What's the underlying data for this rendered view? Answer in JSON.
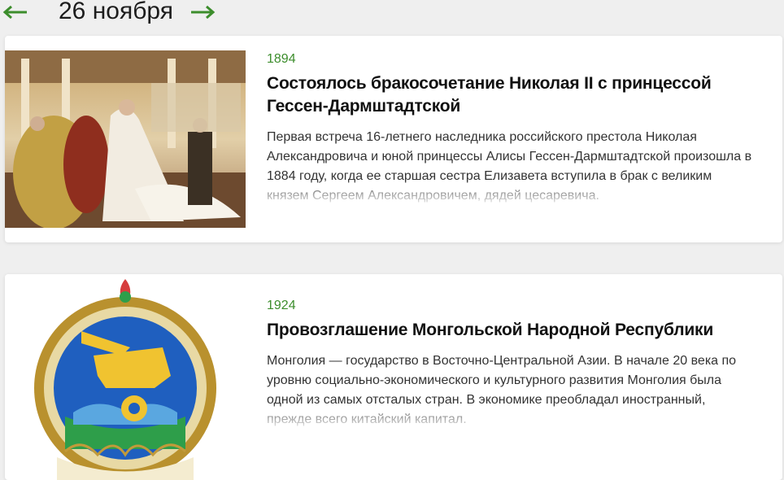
{
  "header": {
    "date": "26 ноября"
  },
  "icons": {
    "prev": "arrow-left-icon",
    "next": "arrow-right-icon"
  },
  "colors": {
    "accent": "#3c8d2c",
    "background": "#efefef"
  },
  "events": [
    {
      "year": "1894",
      "title": "Состоялось бракосочетание Николая II с принцессой Гессен-Дармштадтской",
      "summary": "Первая встреча 16-летнего наследника российского престола Николая Александровича и юной принцессы Алисы Гессен-Дармштадтской произошла в 1884 году, когда ее старшая сестра Елизавета вступила в брак с великим князем Сергеем Александровичем, дядей цесаревича."
    },
    {
      "year": "1924",
      "title": "Провозглашение Монгольской Народной Республики",
      "summary": "Монголия — государство в Восточно-Центральной Азии. В начале 20 века по уровню социально-экономического и культурного развития Монголия была одной из самых отсталых стран. В экономике преобладал иностранный, прежде всего китайский капитал."
    }
  ]
}
